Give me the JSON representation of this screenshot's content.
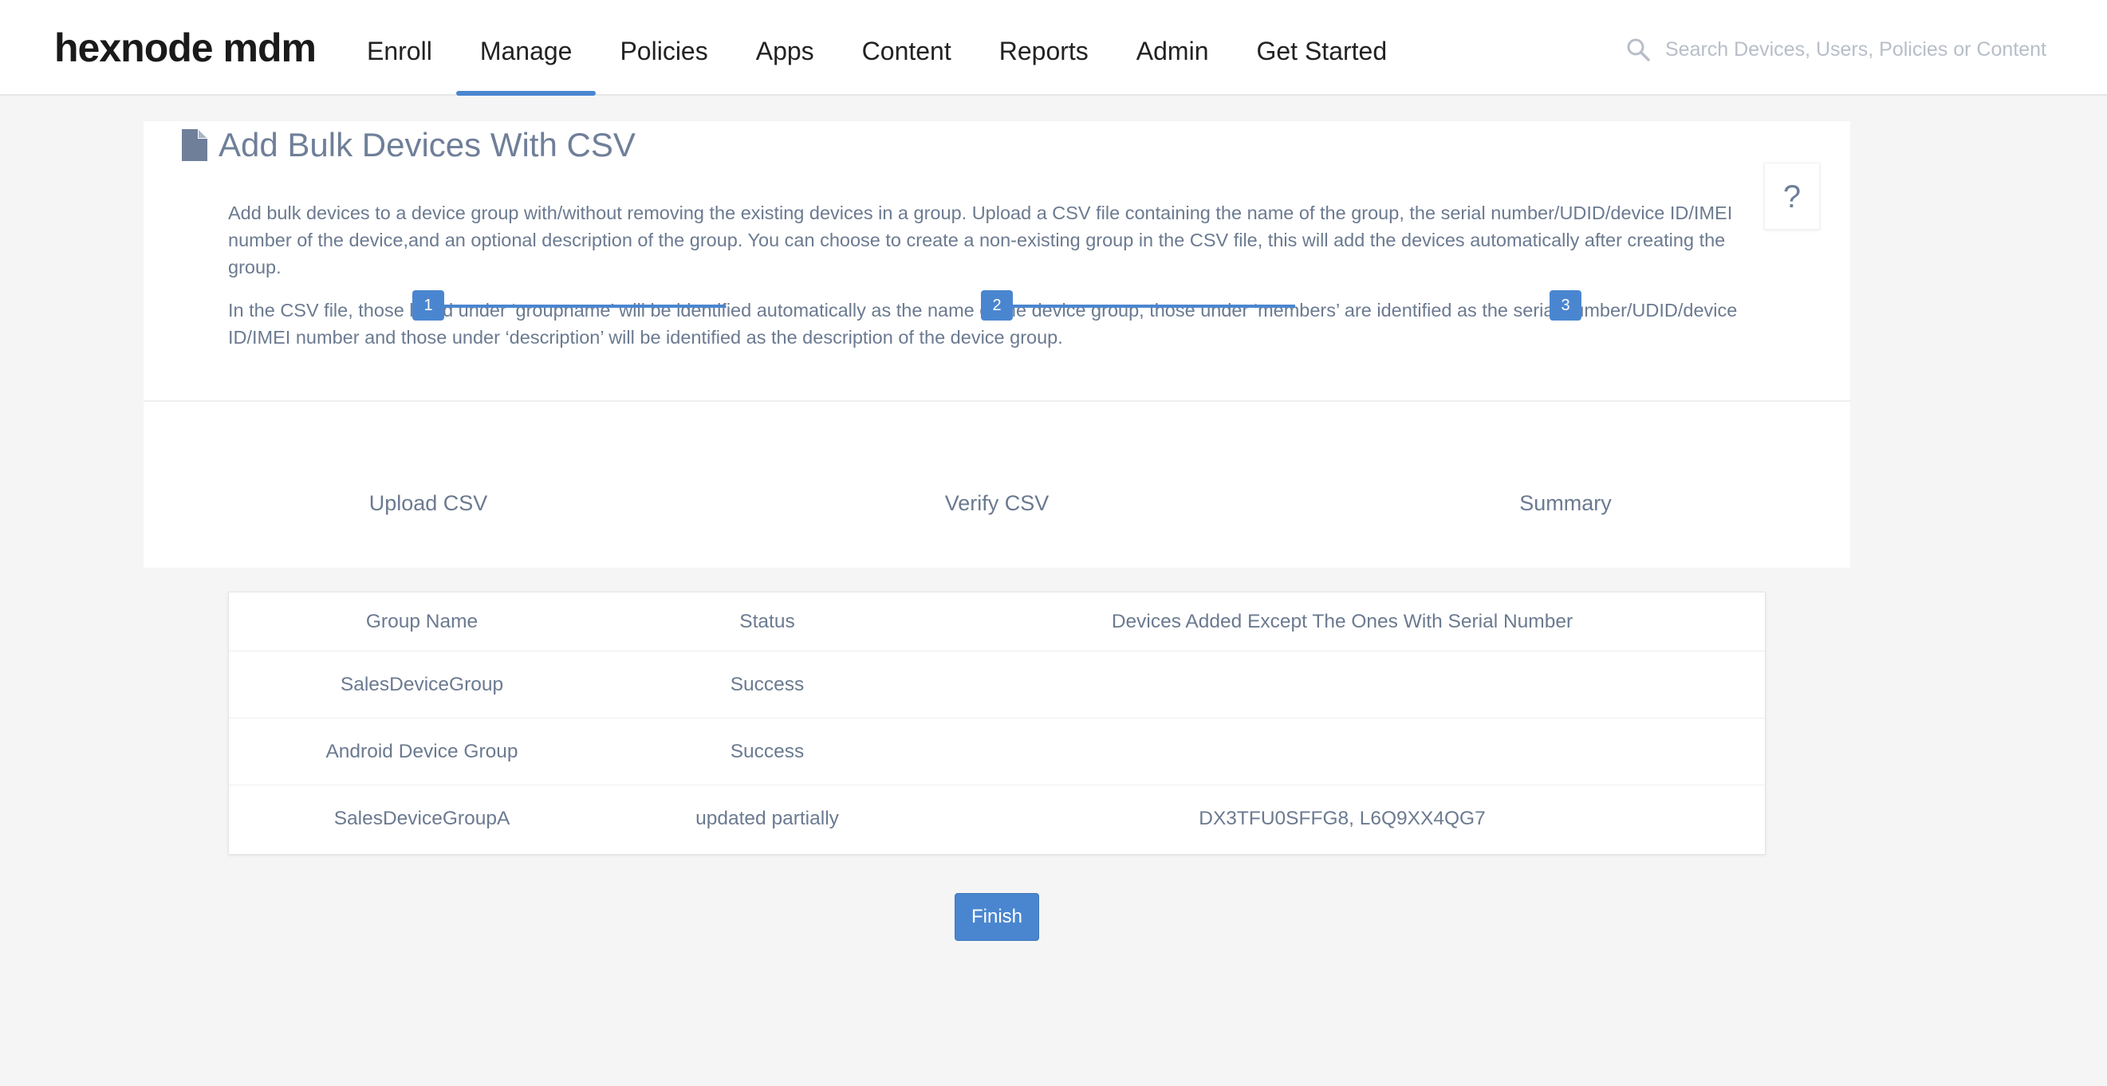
{
  "header": {
    "logo": "hexnode mdm",
    "nav": [
      {
        "label": "Enroll"
      },
      {
        "label": "Manage"
      },
      {
        "label": "Policies"
      },
      {
        "label": "Apps"
      },
      {
        "label": "Content"
      },
      {
        "label": "Reports"
      },
      {
        "label": "Admin"
      },
      {
        "label": "Get Started"
      }
    ],
    "active_nav": "Manage",
    "search": {
      "placeholder": "Search Devices, Users, Policies or Content",
      "icon": "search-icon"
    }
  },
  "page": {
    "title": "Add Bulk Devices With CSV",
    "title_icon": "document-icon",
    "help_label": "?",
    "description": [
      "Add bulk devices to a device group with/without removing the existing devices in a group. Upload a CSV file containing the name of the group, the serial number/UDID/device ID/IMEI number of the device,and an optional description of the group. You can choose to create a non-existing group in the CSV file, this will add the devices automatically after creating the group.",
      "In the CSV file, those listed under ‘groupname’ will be identified automatically as the name of the device group, those under ‘members’ are identified as the serial number/UDID/device ID/IMEI number and those under ‘description’ will be identified as the description of the device group."
    ]
  },
  "stepper": {
    "steps": [
      {
        "number": "1",
        "label": "Upload CSV"
      },
      {
        "number": "2",
        "label": "Verify CSV"
      },
      {
        "number": "3",
        "label": "Summary"
      }
    ]
  },
  "summary_table": {
    "columns": [
      "Group Name",
      "Status",
      "Devices Added Except The Ones With Serial Number"
    ],
    "rows": [
      [
        "SalesDeviceGroup",
        "Success",
        ""
      ],
      [
        "Android Device Group",
        "Success",
        ""
      ],
      [
        "SalesDeviceGroupA",
        "updated partially",
        "DX3TFU0SFFG8, L6Q9XX4QG7"
      ]
    ]
  },
  "actions": {
    "finish_label": "Finish"
  },
  "colors": {
    "accent": "#4a86d0",
    "text": "#6b7a90",
    "background": "#f5f5f5"
  }
}
